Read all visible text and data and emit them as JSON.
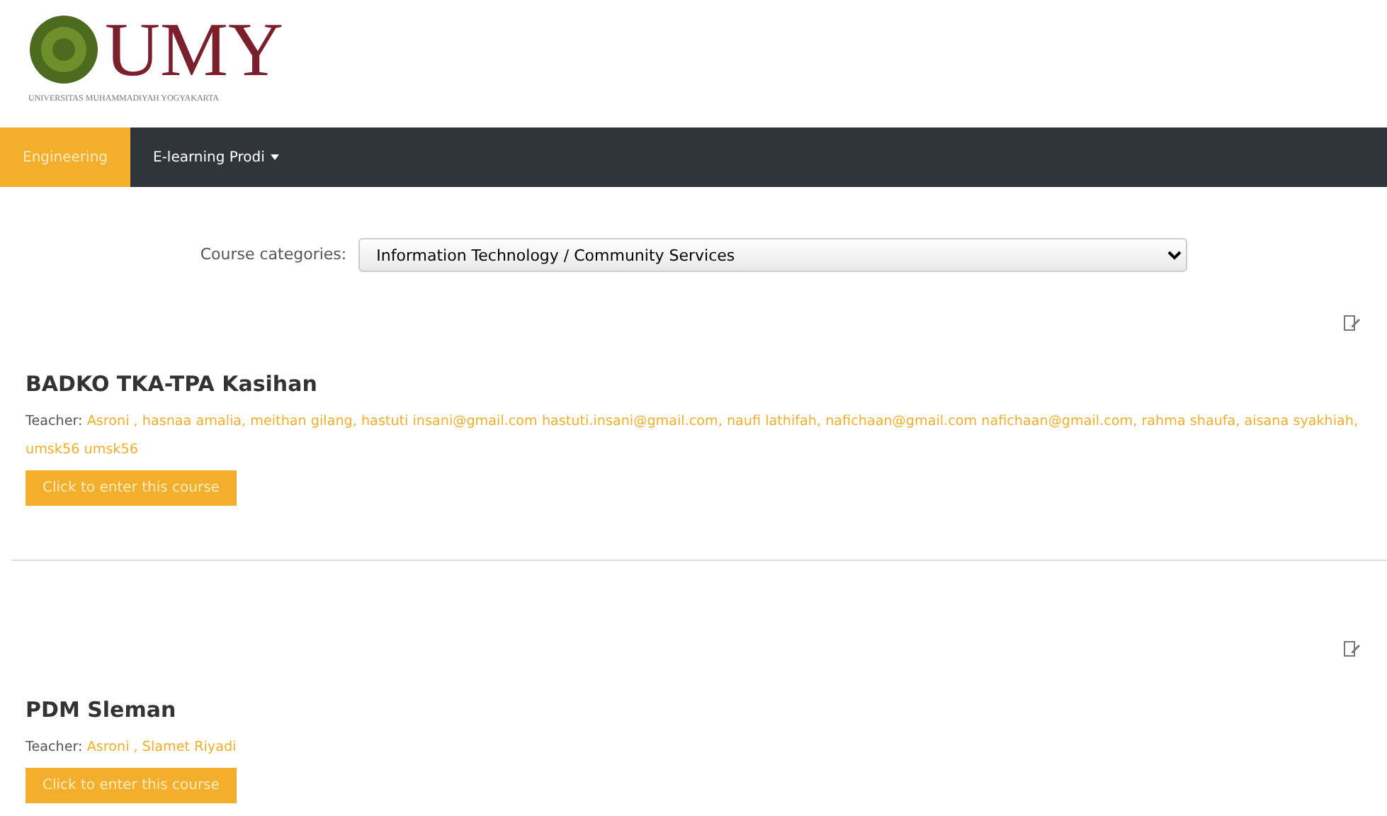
{
  "logo": {
    "title": "UMY",
    "subtitle": "UNIVERSITAS MUHAMMADIYAH YOGYAKARTA"
  },
  "nav": [
    {
      "label": "Engineering",
      "selected": true,
      "dropdown": false
    },
    {
      "label": "E-learning Prodi",
      "selected": false,
      "dropdown": true
    }
  ],
  "category_filter": {
    "label": "Course categories:",
    "value": "Information Technology / Community Services"
  },
  "courses": [
    {
      "title": "BADKO TKA-TPA Kasihan",
      "teacher_label": "Teacher:",
      "teachers": "Asroni , hasnaa amalia, meithan gilang, hastuti insani@gmail.com hastuti.insani@gmail.com, naufi lathifah, nafichaan@gmail.com nafichaan@gmail.com, rahma shaufa, aisana syakhiah, umsk56 umsk56",
      "button": "Click to enter this course"
    },
    {
      "title": "PDM Sleman",
      "teacher_label": "Teacher:",
      "teachers": "Asroni , Slamet Riyadi",
      "button": "Click to enter this course"
    }
  ]
}
